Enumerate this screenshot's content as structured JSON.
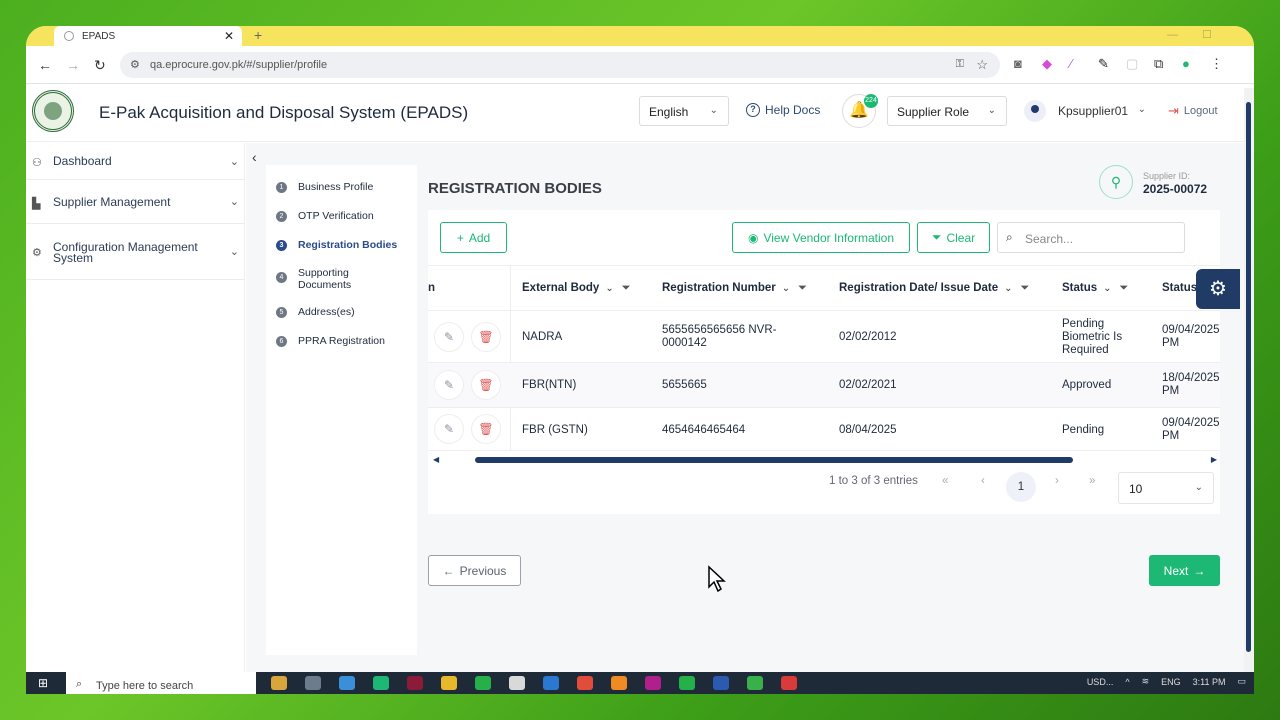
{
  "browser": {
    "tab_title": "EPADS",
    "new_tab": "+",
    "close": "✕",
    "url": "qa.eprocure.gov.pk/#/supplier/profile"
  },
  "header": {
    "title": "E-Pak Acquisition and Disposal System (EPADS)",
    "language": "English",
    "help": "Help Docs",
    "notifications": "224",
    "role": "Supplier Role",
    "user": "Kpsupplier01",
    "logout": "Logout"
  },
  "sidebar": {
    "items": [
      {
        "label": "Dashboard"
      },
      {
        "label": "Supplier Management"
      },
      {
        "label": "Configuration Management System"
      }
    ]
  },
  "steps": [
    {
      "num": "1",
      "label": "Business Profile"
    },
    {
      "num": "2",
      "label": "OTP Verification"
    },
    {
      "num": "3",
      "label": "Registration Bodies"
    },
    {
      "num": "4",
      "label": "Supporting Documents"
    },
    {
      "num": "5",
      "label": "Address(es)"
    },
    {
      "num": "6",
      "label": "PPRA Registration"
    }
  ],
  "page": {
    "heading": "REGISTRATION BODIES",
    "supplier_id_label": "Supplier ID:",
    "supplier_id": "2025-00072"
  },
  "toolbar": {
    "add": "Add",
    "view_vendor": "View Vendor Information",
    "clear": "Clear",
    "search_placeholder": "Search..."
  },
  "table": {
    "first_col_fragment": "n",
    "columns": [
      "External Body",
      "Registration Number",
      "Registration Date/ Issue Date",
      "Status",
      "Status I"
    ],
    "rows": [
      {
        "body": "NADRA",
        "reg_no": "5655656565656 NVR-0000142",
        "date": "02/02/2012",
        "status": "Pending Biometric Is Required",
        "status_date": "09/04/2025 PM"
      },
      {
        "body": "FBR(NTN)",
        "reg_no": "5655665",
        "date": "02/02/2021",
        "status": "Approved",
        "status_date": "18/04/2025 PM"
      },
      {
        "body": "FBR (GSTN)",
        "reg_no": "4654646465464",
        "date": "08/04/2025",
        "status": "Pending",
        "status_date": "09/04/2025 PM"
      }
    ]
  },
  "pagination": {
    "summary": "1 to 3 of 3 entries",
    "current": "1",
    "per_page": "10"
  },
  "nav": {
    "previous": "Previous",
    "next": "Next"
  },
  "taskbar": {
    "search": "Type here to search",
    "currency": "USD...",
    "lang": "ENG",
    "time": "3:11 PM"
  },
  "colors": {
    "accent": "#1db874",
    "primary": "#1f3b66",
    "browser_frame": "#f7e45e"
  }
}
